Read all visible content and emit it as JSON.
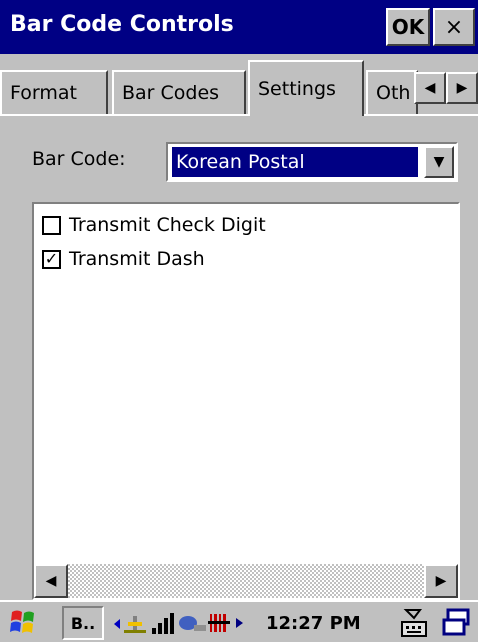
{
  "window": {
    "title": "Bar Code Controls",
    "ok_label": "OK",
    "close_label": "×"
  },
  "tabs": [
    {
      "label": "Format",
      "active": false
    },
    {
      "label": "Bar Codes",
      "active": false
    },
    {
      "label": "Settings",
      "active": true
    },
    {
      "label": "Oth",
      "active": false
    }
  ],
  "tab_scroll": {
    "left": "◀",
    "right": "▶"
  },
  "barcode": {
    "label": "Bar Code:",
    "value": "Korean Postal",
    "dropdown_glyph": "▼"
  },
  "options": [
    {
      "label": "Transmit Check Digit",
      "checked": false,
      "mark": ""
    },
    {
      "label": "Transmit Dash",
      "checked": true,
      "mark": "✓"
    }
  ],
  "scrollbar": {
    "left": "◀",
    "right": "▶"
  },
  "taskbar": {
    "task_label": "B..",
    "clock": "12:27 PM",
    "icons": [
      "start-flag-icon",
      "network-icon",
      "signal-icon",
      "sync-icon",
      "barcode-icon",
      "keyboard-icon",
      "window-switch-icon"
    ]
  },
  "colors": {
    "titlebar": "#000084",
    "selection": "#000084",
    "face": "#c0c0c0"
  }
}
